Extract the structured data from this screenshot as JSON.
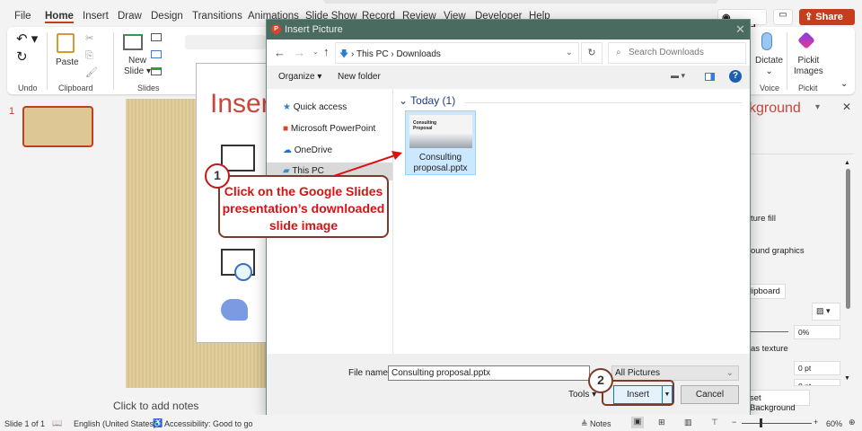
{
  "menu": {
    "tabs": [
      "File",
      "Home",
      "Insert",
      "Draw",
      "Design",
      "Transitions",
      "Animations",
      "Slide Show",
      "Record",
      "Review",
      "View",
      "Developer",
      "Help"
    ],
    "active": "Home",
    "record": "Record",
    "share": "Share"
  },
  "ribbon": {
    "undo_group": "Undo",
    "paste": "Paste",
    "clipboard_group": "Clipboard",
    "new_slide": "New",
    "new_slide2": "Slide",
    "slides_group": "Slides",
    "dictate": "Dictate",
    "voice_group": "Voice",
    "pickit": "Pickit",
    "pickit2": "Images",
    "pickit_group": "Pickit"
  },
  "thumbnails": {
    "number": "1"
  },
  "office_dialog": {
    "title": "Insert"
  },
  "notes": {
    "placeholder": "Click to add notes"
  },
  "format_pane": {
    "title": "kground",
    "picture_fill": "ture fill",
    "hide_graphics": "ound graphics",
    "clipboard_btn": "lipboard",
    "transparency": "0%",
    "tile": "as texture",
    "offset1": "0 pt",
    "offset2": "0 pt",
    "reset": "set Background"
  },
  "win_dialog": {
    "title": "Insert Picture",
    "breadcrumb": [
      "This PC",
      "Downloads"
    ],
    "search_placeholder": "Search Downloads",
    "organize": "Organize",
    "new_folder": "New folder",
    "nav": [
      "Quick access",
      "Microsoft PowerPoint",
      "OneDrive",
      "This PC"
    ],
    "group_header": "Today (1)",
    "file": {
      "name1": "Consulting",
      "name2": "proposal.pptx",
      "thumb_title1": "Consulting",
      "thumb_title2": "Proposal"
    },
    "file_name_label": "File name:",
    "file_name_value": "Consulting proposal.pptx",
    "filter": "All Pictures",
    "tools": "Tools",
    "insert": "Insert",
    "cancel": "Cancel"
  },
  "annotations": {
    "step1_num": "1",
    "step1_text": "Click on the Google Slides presentation’s downloaded slide image",
    "step2_num": "2"
  },
  "status": {
    "slide": "Slide 1 of 1",
    "language": "English (United States)",
    "accessibility": "Accessibility: Good to go",
    "notes": "Notes",
    "zoom": "60%"
  },
  "colors": {
    "accent": "#c43e1c",
    "dialog_title": "#4a6b5f",
    "callout": "#d41414",
    "selection": "#cce8ff"
  }
}
